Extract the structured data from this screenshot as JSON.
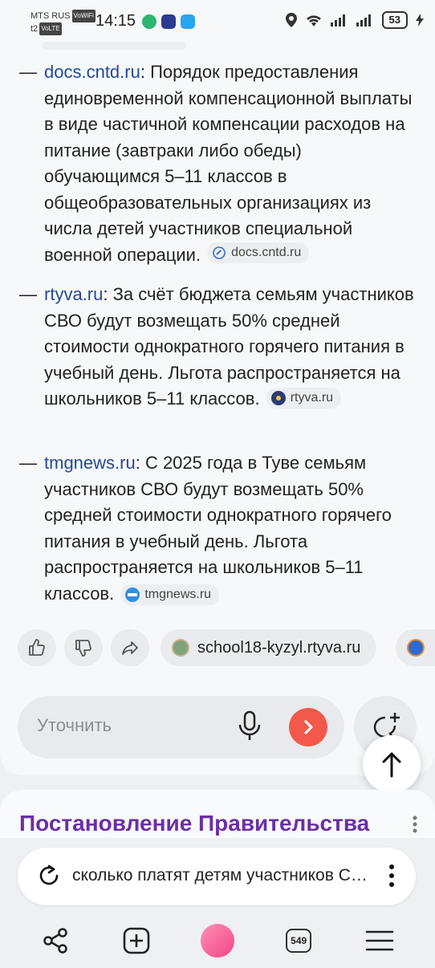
{
  "status": {
    "carrier1": "MTS RUS",
    "carrier1_tag": "VoWiFi",
    "carrier2": "t2",
    "carrier2_tag": "VoLTE",
    "time": "14:15",
    "battery": "53"
  },
  "references": [
    {
      "domain": "docs.cntd.ru",
      "text": ": Порядок предоставления единовременной компенсационной выплаты в виде частичной компенсации расходов на питание (завтраки либо обеды) обучающимся 5–11 классов в общеобразовательных организациях из числа детей участников специальной военной операции.",
      "chip": "docs.cntd.ru"
    },
    {
      "domain": "rtyva.ru",
      "text": ": За счёт бюджета семьям участников СВО будут возмещать 50% средней стоимости однократного горячего питания в учебный день. Льгота распространяется на школьников 5–11 классов.",
      "chip": "rtyva.ru"
    },
    {
      "domain": "tmgnews.ru",
      "text": ": С 2025 года в Туве семьям участников СВО будут возмещать 50% средней стоимости однократного горячего питания в учебный день. Льгота распространяется на школьников 5–11 классов.",
      "chip": "tmgnews.ru"
    }
  ],
  "dash": "—",
  "source_chip": "school18-kyzyl.rtyva.ru",
  "ask": {
    "placeholder": "Уточнить"
  },
  "next_result_title": "Постановление Правительства",
  "query": "сколько платят детям участников СВО",
  "tabs_count": "549",
  "colors": {
    "accent": "#f2594a",
    "link": "#23489c",
    "title": "#6b2fa6"
  }
}
